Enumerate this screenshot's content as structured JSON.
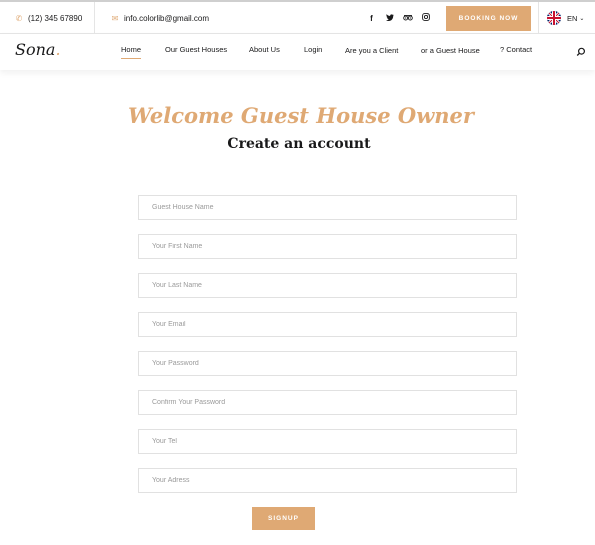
{
  "topbar": {
    "phone": "(12) 345 67890",
    "email": "info.colorlib@gmail.com",
    "social_icons": [
      "facebook-icon",
      "twitter-icon",
      "tripadvisor-icon",
      "instagram-icon"
    ],
    "booking_label": "BOOKING NOW",
    "language": "EN"
  },
  "nav": {
    "logo": "Sona",
    "logo_dot": ".",
    "items": [
      "Home",
      "Our Guest Houses",
      "About Us",
      "Login",
      "Are you a Client",
      "or a Guest House",
      "? Contact"
    ],
    "active_index": 0
  },
  "main": {
    "welcome": "Welcome Guest House Owner",
    "subtitle": "Create an account"
  },
  "form": {
    "placeholders": [
      "Guest House Name",
      "Your First Name",
      "Your Last Name",
      "Your Email",
      "Your Password",
      "Confirm Your Password",
      "Your Tel",
      "Your Adress"
    ],
    "submit_label": "SIGNUP"
  },
  "colors": {
    "accent": "#dfa974",
    "text": "#19191a",
    "border": "#e1e1e1"
  }
}
